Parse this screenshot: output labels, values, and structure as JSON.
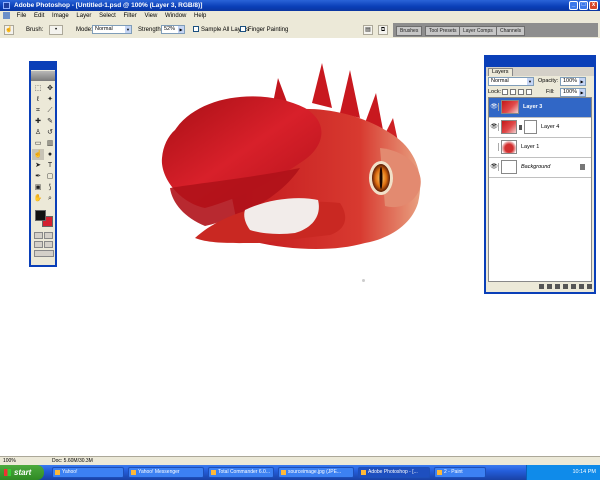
{
  "window": {
    "title": "Adobe Photoshop - [Untitled-1.psd @ 100% (Layer 3, RGB/8)]",
    "btn_min": "_",
    "btn_max": "□",
    "btn_close": "x"
  },
  "menu": [
    "File",
    "Edit",
    "Image",
    "Layer",
    "Select",
    "Filter",
    "View",
    "Window",
    "Help"
  ],
  "options": {
    "brush_label": "Brush:",
    "mode_label": "Mode:",
    "mode_value": "Normal",
    "strength_label": "Strength:",
    "strength_value": "52%",
    "sample_all_layers": "Sample All Layers",
    "finger_painting": "Finger Painting"
  },
  "palette_well": {
    "tabs": [
      "Brushes",
      "Tool Presets",
      "Layer Comps",
      "Channels"
    ]
  },
  "layers_panel": {
    "tab": "Layers",
    "blend_mode": "Normal",
    "opacity_label": "Opacity:",
    "opacity_value": "100%",
    "lock_label": "Lock:",
    "fill_label": "Fill:",
    "fill_value": "100%",
    "layers": [
      {
        "name": "Layer 3",
        "selected": true,
        "visible": true
      },
      {
        "name": "Layer 4",
        "selected": false,
        "visible": true
      },
      {
        "name": "Layer 1",
        "selected": false,
        "visible": false
      },
      {
        "name": "Background",
        "selected": false,
        "visible": true,
        "locked": true
      }
    ]
  },
  "status": {
    "zoom": "100%",
    "doc": "Doc: 5.60M/30.3M"
  },
  "taskbar": {
    "start": "start",
    "items": [
      "Yahoo!",
      "Yahoo! Messenger",
      "Total Commander 6.0...",
      "sourceimage.jpg (JPE...",
      "Adobe Photoshop - [...",
      "2 - Paint"
    ],
    "clock": "10:14 PM"
  },
  "icons": {
    "eye": "👁",
    "lock": "lock-icon"
  }
}
